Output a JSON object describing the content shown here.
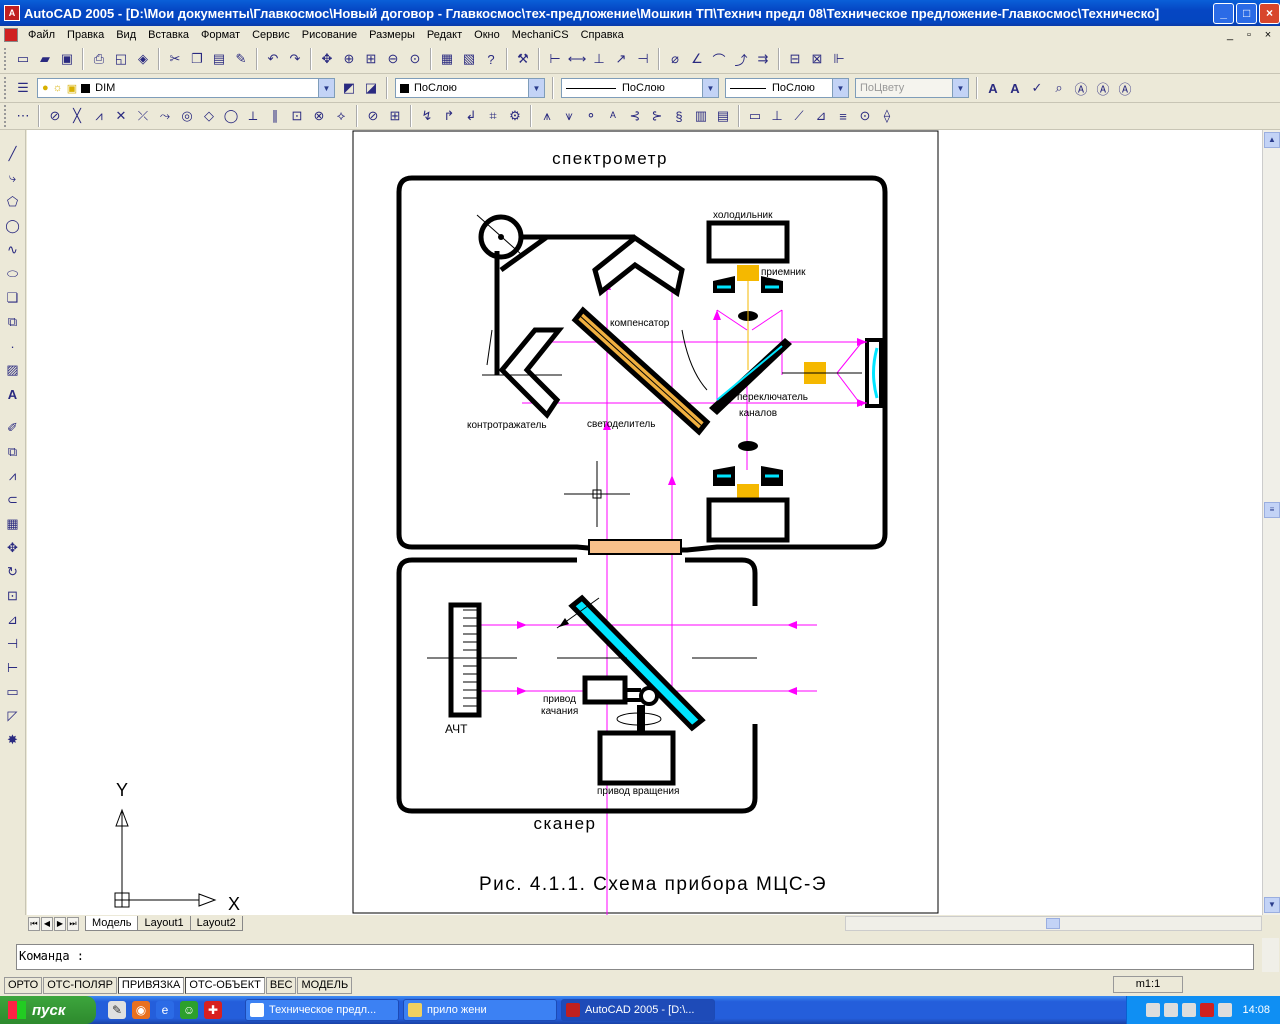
{
  "window": {
    "title": "AutoCAD 2005 - [D:\\Мои документы\\Главкосмос\\Новый договор - Главкосмос\\тех-предложение\\Мошкин ТП\\Технич предл 08\\Техническое предложение-Главкосмос\\Техническо]",
    "app_icon": "autocad-icon",
    "minimize": "_",
    "maximize": "□",
    "close": "×"
  },
  "menu": {
    "items": [
      "Файл",
      "Правка",
      "Вид",
      "Вставка",
      "Формат",
      "Сервис",
      "Рисование",
      "Размеры",
      "Редакт",
      "Окно",
      "MechaniCS",
      "Справка"
    ]
  },
  "layer_toolbar": {
    "layer_name": "DIM",
    "color_value": "ПоСлою",
    "linetype_value": "ПоСлою",
    "lineweight_value": "ПоСлою",
    "plotstyle_value": "ПоЦвету"
  },
  "layout_tabs": {
    "tabs": [
      "Модель",
      "Layout1",
      "Layout2"
    ],
    "active": "Модель"
  },
  "command": {
    "prompt": "Команда :"
  },
  "status": {
    "buttons": [
      "ОРТО",
      "ОТС-ПОЛЯР",
      "ПРИВЯЗКА",
      "ОТС-ОБЪЕКТ",
      "ВЕС",
      "МОДЕЛЬ"
    ],
    "scale": "m1:1"
  },
  "ucs": {
    "x_label": "X",
    "y_label": "Y"
  },
  "drawing": {
    "title_top": "спектрометр",
    "title_bottom": "сканер",
    "caption": "Рис. 4.1.1. Схема прибора МЦС-Э",
    "labels": {
      "cooler": "холодильник",
      "receiver": "приемник",
      "compensator": "компенсатор",
      "counter_reflector": "контротражатель",
      "beamsplitter": "светоделитель",
      "switch_line1": "переключатель",
      "switch_line2": "каналов",
      "blackbody": "АЧТ",
      "swing_drive_line1": "привод",
      "swing_drive_line2": "качания",
      "rotation_drive": "привод вращения"
    },
    "colors": {
      "outline": "#000000",
      "beam": "#ff00ff",
      "detector": "#f5b800",
      "mirror": "#00e5ff",
      "splitter": "#f0b040",
      "window": "#f8c08a"
    }
  },
  "taskbar": {
    "start_label": "пуск",
    "tasks": [
      "Техническое предл...",
      "прило жени",
      "AutoCAD 2005 - [D:\\..."
    ],
    "active_task": "AutoCAD 2005 - [D:\\...",
    "clock": "14:08"
  }
}
